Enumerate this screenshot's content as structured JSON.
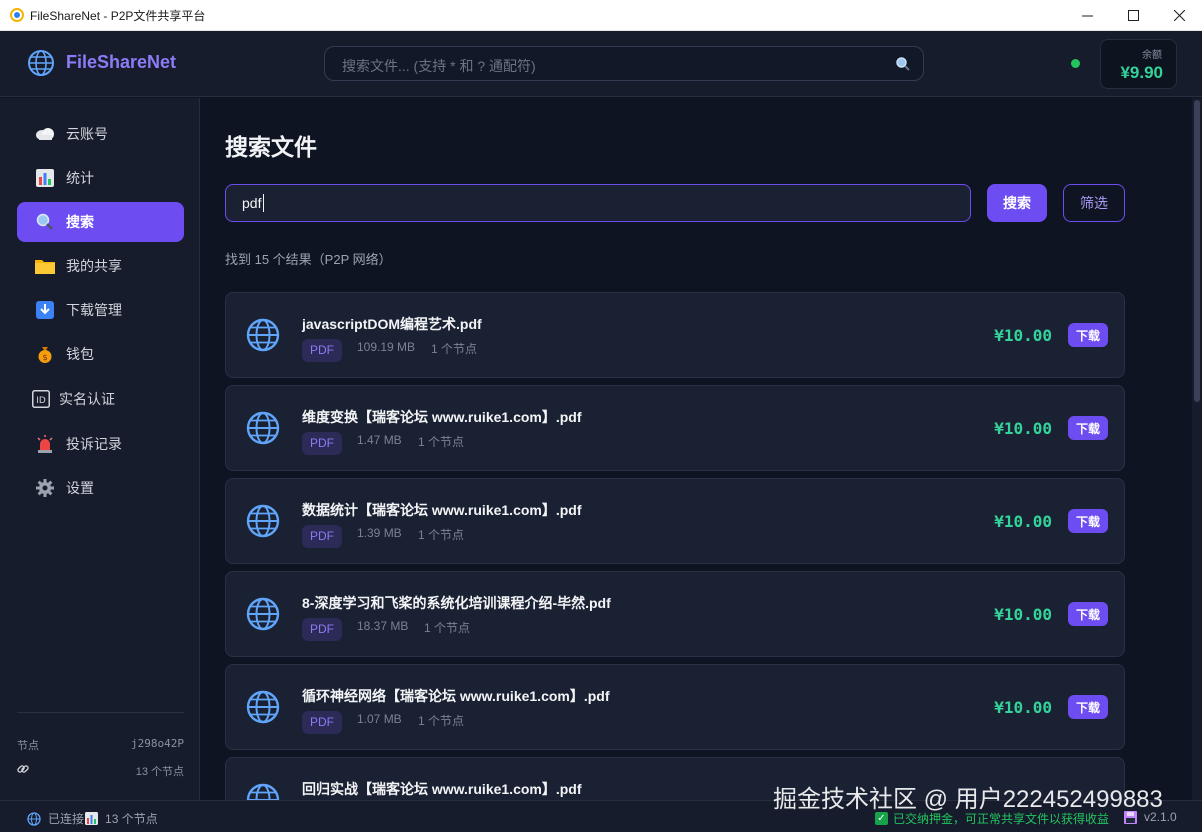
{
  "window": {
    "title": "FileShareNet - P2P文件共享平台"
  },
  "header": {
    "brand": "FileShareNet",
    "search_placeholder": "搜索文件... (支持 * 和 ? 通配符)",
    "balance_label": "余额",
    "balance_value": "¥9.90"
  },
  "sidebar": {
    "items": [
      {
        "label": "云账号",
        "icon": "cloud-icon"
      },
      {
        "label": "统计",
        "icon": "chart-icon"
      },
      {
        "label": "搜索",
        "icon": "search-icon"
      },
      {
        "label": "我的共享",
        "icon": "folder-icon"
      },
      {
        "label": "下载管理",
        "icon": "download-icon"
      },
      {
        "label": "钱包",
        "icon": "money-bag-icon"
      },
      {
        "label": "实名认证",
        "icon": "id-icon"
      },
      {
        "label": "投诉记录",
        "icon": "alarm-icon"
      },
      {
        "label": "设置",
        "icon": "gear-icon"
      }
    ],
    "footer": {
      "node_label": "节点",
      "node_id": "j298o42P",
      "peer_count": "13 个节点"
    }
  },
  "main": {
    "title": "搜索文件",
    "query": "pdf",
    "search_button": "搜索",
    "filter_button": "筛选",
    "result_count": "找到 15 个结果（P2P 网络）",
    "results": [
      {
        "name": "javascriptDOM编程艺术.pdf",
        "type": "PDF",
        "size": "109.19 MB",
        "nodes": "1 个节点",
        "price": "¥10.00",
        "action": "下载"
      },
      {
        "name": "维度变换【瑞客论坛 www.ruike1.com】.pdf",
        "type": "PDF",
        "size": "1.47 MB",
        "nodes": "1 个节点",
        "price": "¥10.00",
        "action": "下载"
      },
      {
        "name": "数据统计【瑞客论坛 www.ruike1.com】.pdf",
        "type": "PDF",
        "size": "1.39 MB",
        "nodes": "1 个节点",
        "price": "¥10.00",
        "action": "下载"
      },
      {
        "name": "8-深度学习和飞桨的系统化培训课程介绍-毕然.pdf",
        "type": "PDF",
        "size": "18.37 MB",
        "nodes": "1 个节点",
        "price": "¥10.00",
        "action": "下载"
      },
      {
        "name": "循环神经网络【瑞客论坛 www.ruike1.com】.pdf",
        "type": "PDF",
        "size": "1.07 MB",
        "nodes": "1 个节点",
        "price": "¥10.00",
        "action": "下载"
      },
      {
        "name": "回归实战【瑞客论坛 www.ruike1.com】.pdf",
        "type": "PDF",
        "size": "",
        "nodes": "",
        "price": "",
        "action": ""
      }
    ]
  },
  "statusbar": {
    "connection": "已连接",
    "peers": "13 个节点",
    "deposit_notice": "已交纳押金，可正常共享文件以获得收益",
    "version": "v2.1.0"
  },
  "watermark": "掘金技术社区 @ 用户222452499883",
  "colors": {
    "accent": "#6d4df2",
    "price": "#34d399",
    "online": "#22c55e"
  }
}
